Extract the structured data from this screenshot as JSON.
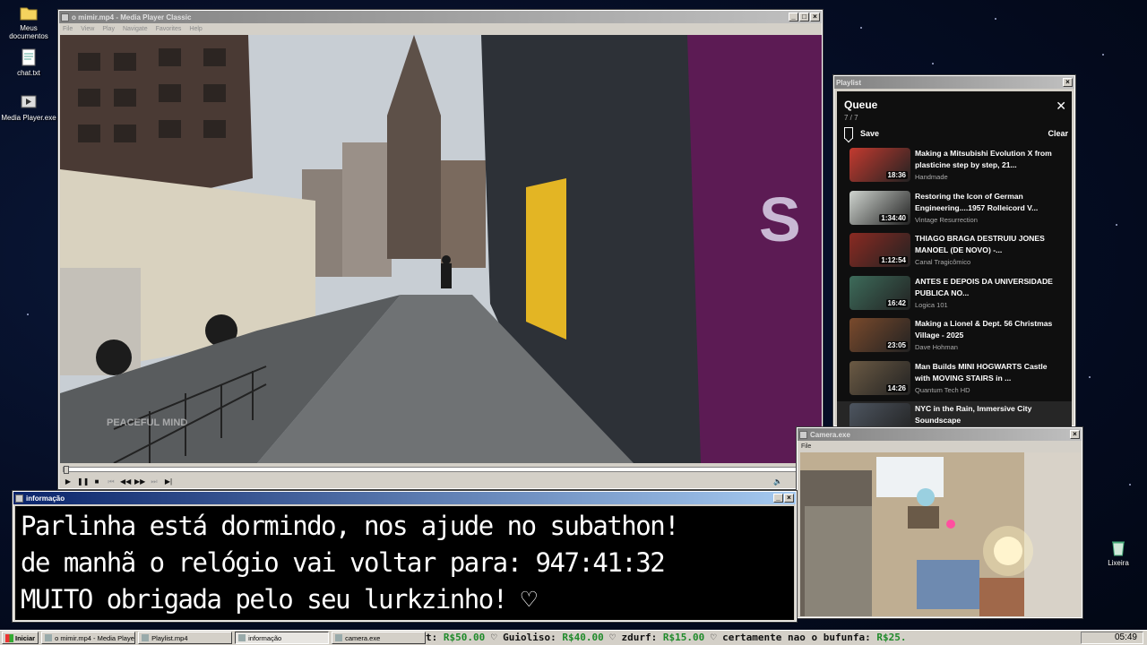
{
  "desktop": {
    "icons": [
      {
        "label": "Meus documentos",
        "icon": "folder-icon"
      },
      {
        "label": "chat.txt",
        "icon": "text-file-icon"
      },
      {
        "label": "Media Player.exe",
        "icon": "media-player-icon"
      },
      {
        "label": "Lixeira",
        "icon": "recycle-bin-icon"
      }
    ]
  },
  "mpc": {
    "title": "o mimir.mp4 - Media Player Classic",
    "menu": [
      "File",
      "View",
      "Play",
      "Navigate",
      "Favorites",
      "Help"
    ],
    "watermark": "PEACEFUL MIND",
    "seek_position": 0.0
  },
  "playlist": {
    "window_title": "Playlist",
    "queue_title": "Queue",
    "count": "7 / 7",
    "save_label": "Save",
    "clear_label": "Clear",
    "items": [
      {
        "title": "Making a Mitsubishi Evolution X from plasticine step by step, 21...",
        "channel": "Handmade",
        "duration": "18:36",
        "thumb_color": "#c33a2f"
      },
      {
        "title": "Restoring the Icon of German Engineering....1957 Rolleicord V...",
        "channel": "Vintage Resurrection",
        "duration": "1:34:40",
        "thumb_color": "#cfd4cf"
      },
      {
        "title": "THIAGO BRAGA DESTRUIU JONES MANOEL (DE NOVO) -...",
        "channel": "Canal Tragicômico",
        "duration": "1:12:54",
        "thumb_color": "#8a2a22"
      },
      {
        "title": "ANTES E DEPOIS DA UNIVERSIDADE PUBLICA NO...",
        "channel": "Logica 101",
        "duration": "16:42",
        "thumb_color": "#3d6b5a"
      },
      {
        "title": "Making a Lionel & Dept. 56 Christmas Village - 2025",
        "channel": "Dave Hohman",
        "duration": "23:05",
        "thumb_color": "#7a4a2c"
      },
      {
        "title": "Man Builds MINI HOGWARTS Castle with MOVING STAIRS in ...",
        "channel": "Quantum Tech HD",
        "duration": "14:26",
        "thumb_color": "#6b5a44"
      },
      {
        "title": "NYC in the Rain, Immersive City Soundscape",
        "channel": "",
        "duration": "",
        "thumb_color": "#4d5560"
      }
    ]
  },
  "camera": {
    "title": "Camera.exe",
    "menu": [
      "File"
    ]
  },
  "info": {
    "title": "informação",
    "lines": [
      "Parlinha está dormindo, nos ajude no subathon!",
      "de manhã o relógio vai voltar para:  947:41:32",
      "MUITO obrigada pelo seu lurkzinho! ♡"
    ]
  },
  "taskbar": {
    "start_label": "Iniciar",
    "tasks": [
      {
        "label": "o mimir.mp4 - Media Playe...",
        "active": false
      },
      {
        "label": "Playlist.mp4",
        "active": false
      },
      {
        "label": "informação",
        "active": true
      },
      {
        "label": "camera.exe",
        "active": false
      }
    ],
    "ticker": [
      {
        "text": "t: ",
        "money": "R$50.00"
      },
      {
        "text": " ♡ Guioliso: ",
        "money": "R$40.00"
      },
      {
        "text": " ♡ zdurf: ",
        "money": "R$15.00"
      },
      {
        "text": " ♡ certamente nao o bufunfa: ",
        "money": "R$25."
      }
    ],
    "clock": "05:49"
  }
}
